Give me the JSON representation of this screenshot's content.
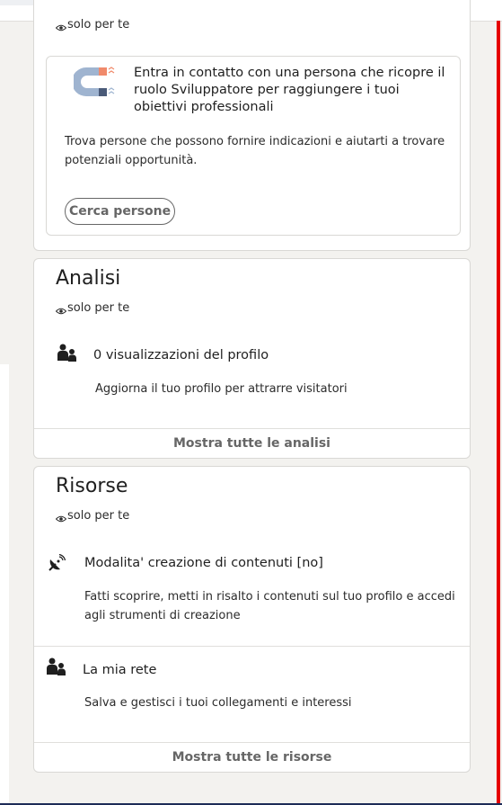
{
  "visibility_label": "solo per te",
  "top_card": {
    "suggestion_title": "Entra in contatto con una persona che ricopre il ruolo Sviluppatore per raggiungere i tuoi obiettivi professionali",
    "suggestion_desc": "Trova persone che possono fornire indicazioni e aiutarti a trovare potenziali opportunità.",
    "button_label": "Cerca persone"
  },
  "analisi": {
    "title": "Analisi",
    "item_title": "0 visualizzazioni del profilo",
    "item_desc": "Aggiorna il tuo profilo per attrarre visitatori",
    "footer_link": "Mostra tutte le analisi"
  },
  "risorse": {
    "title": "Risorse",
    "items": [
      {
        "title": "Modalita' creazione di contenuti [no]",
        "desc": "Fatti scoprire, metti in risalto i contenuti sul tuo profilo e accedi agli strumenti di creazione",
        "icon": "satellite-dish-icon"
      },
      {
        "title": "La mia rete",
        "desc": "Salva e gestisci i tuoi collegamenti e interessi",
        "icon": "people-icon"
      }
    ],
    "footer_link": "Mostra tutte le risorse"
  },
  "colors": {
    "accent_red": "#e60000",
    "magnet_orange": "#f08a6b",
    "magnet_blue": "#9fb4d0"
  }
}
